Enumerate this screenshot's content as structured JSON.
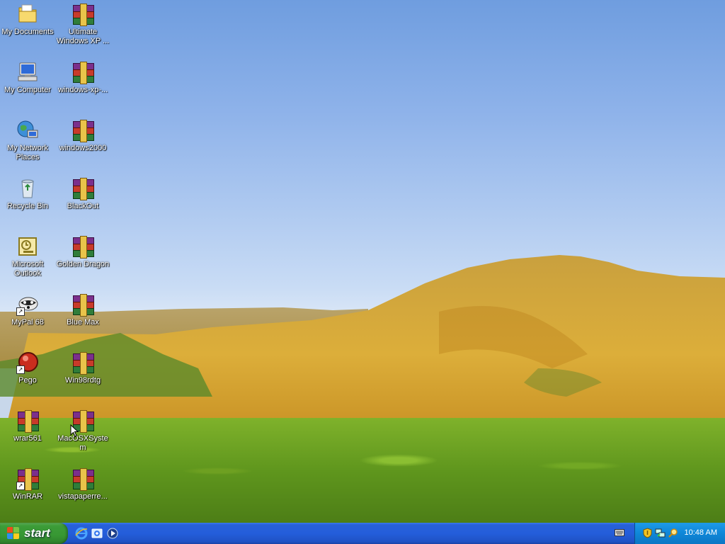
{
  "desktop": {
    "icons": [
      {
        "label": "My Documents",
        "icon": "folder-icon",
        "shortcut": false
      },
      {
        "label": "Ultimate Windows XP ...",
        "icon": "winrar-archive-icon",
        "shortcut": false
      },
      {
        "label": "My Computer",
        "icon": "computer-icon",
        "shortcut": false
      },
      {
        "label": "windows-xp-...",
        "icon": "winrar-archive-icon",
        "shortcut": false
      },
      {
        "label": "My Network Places",
        "icon": "network-places-icon",
        "shortcut": false
      },
      {
        "label": "windows2000",
        "icon": "winrar-archive-icon",
        "shortcut": false
      },
      {
        "label": "Recycle Bin",
        "icon": "recycle-bin-icon",
        "shortcut": false
      },
      {
        "label": "BlackOut",
        "icon": "winrar-archive-icon",
        "shortcut": false
      },
      {
        "label": "Microsoft Outlook",
        "icon": "outlook-icon",
        "shortcut": false
      },
      {
        "label": "Golden Dragon",
        "icon": "winrar-archive-icon",
        "shortcut": false
      },
      {
        "label": "MyPal 68",
        "icon": "raccoon-icon",
        "shortcut": true
      },
      {
        "label": "Blue Max",
        "icon": "winrar-archive-icon",
        "shortcut": false
      },
      {
        "label": "Pego",
        "icon": "pego-icon",
        "shortcut": true
      },
      {
        "label": "Win98rdtg",
        "icon": "winrar-archive-icon",
        "shortcut": false
      },
      {
        "label": "wrar561",
        "icon": "winrar-archive-icon",
        "shortcut": false
      },
      {
        "label": "MacOSXSystem",
        "icon": "winrar-archive-icon",
        "shortcut": false
      },
      {
        "label": "WinRAR",
        "icon": "winrar-archive-icon",
        "shortcut": true
      },
      {
        "label": "vistapaperre...",
        "icon": "winrar-archive-icon",
        "shortcut": false
      }
    ]
  },
  "taskbar": {
    "start_label": "start",
    "quick_launch": [
      "internet-explorer-icon",
      "show-desktop-icon",
      "media-player-icon"
    ],
    "tray_icons": [
      "security-shield-icon",
      "network-icon",
      "search-icon"
    ],
    "clock": "10:48 AM"
  },
  "colors": {
    "taskbar": "#245edb",
    "start_button": "#379733",
    "tray": "#0f87d8"
  }
}
